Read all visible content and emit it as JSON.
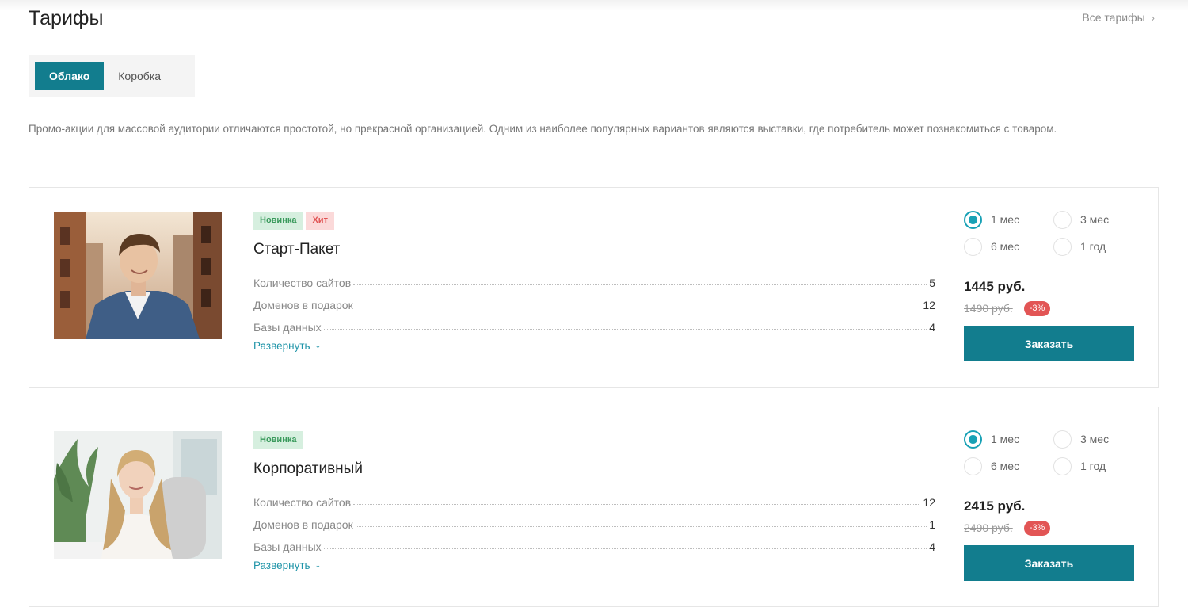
{
  "header": {
    "title": "Тарифы",
    "all_link": "Все тарифы",
    "all_link_icon": "chevron-right-icon"
  },
  "tabs": [
    {
      "label": "Облако",
      "active": true
    },
    {
      "label": "Коробка",
      "active": false
    }
  ],
  "promo_text": "Промо-акции для массовой аудитории отличаются простотой, но прекрасной организацией. Одним из наиболее популярных вариантов являются выставки, где потребитель может познакомиться с товаром.",
  "colors": {
    "accent": "#127d8e",
    "radio": "#18a1b5",
    "discount": "#e25555",
    "badge_new": "#d6efdf",
    "badge_hit": "#fbd9d9"
  },
  "plans": [
    {
      "badges": [
        "Новинка",
        "Хит"
      ],
      "name": "Старт-Пакет",
      "photo": "young-man-photo",
      "specs": [
        {
          "label": "Количество сайтов",
          "value": "5"
        },
        {
          "label": "Доменов в подарок",
          "value": "12"
        },
        {
          "label": "Базы данных",
          "value": "4"
        }
      ],
      "expand": "Развернуть",
      "periods": [
        "1 мес",
        "3 мес",
        "6 мес",
        "1 год"
      ],
      "selected_period": "1 мес",
      "price": "1445 руб.",
      "old_price": "1490 руб.",
      "discount": "-3%",
      "order": "Заказать"
    },
    {
      "badges": [
        "Новинка"
      ],
      "name": "Корпоративный",
      "photo": "young-woman-photo",
      "specs": [
        {
          "label": "Количество сайтов",
          "value": "12"
        },
        {
          "label": "Доменов в подарок",
          "value": "1"
        },
        {
          "label": "Базы данных",
          "value": "4"
        }
      ],
      "expand": "Развернуть",
      "periods": [
        "1 мес",
        "3 мес",
        "6 мес",
        "1 год"
      ],
      "selected_period": "1 мес",
      "price": "2415 руб.",
      "old_price": "2490 руб.",
      "discount": "-3%",
      "order": "Заказать"
    }
  ]
}
